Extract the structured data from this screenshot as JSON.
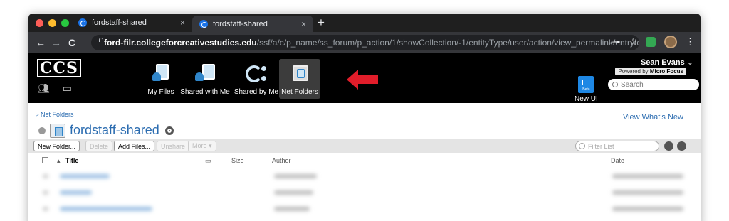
{
  "browser": {
    "tabs": [
      {
        "title": "fordstaff-shared",
        "close": "×"
      },
      {
        "title": "fordstaff-shared",
        "close": "×"
      }
    ],
    "new_tab": "+",
    "nav": {
      "back": "←",
      "forward": "→",
      "reload": "C"
    },
    "url_host": "ford-filr.collegeforcreativestudies.edu",
    "url_path": "/ssf/a/c/p_name/ss_forum/p_action/1/showCollection/-1/entityType/user/action/view_permalink/entryId/ss_us..."
  },
  "app": {
    "logo": "CCS",
    "nav_items": [
      {
        "label": "My Files"
      },
      {
        "label": "Shared with Me"
      },
      {
        "label": "Shared by Me"
      },
      {
        "label": "Net Folders"
      }
    ],
    "new_ui": {
      "label": "New UI",
      "badge": "Beta"
    },
    "user_name": "Sean Evans",
    "powered_by_prefix": "Powered by",
    "powered_by_brand": "Micro Focus",
    "search_placeholder": "Search"
  },
  "content": {
    "breadcrumb": "Net Folders",
    "view_whats_new": "View What's New",
    "folder_title": "fordstaff-shared",
    "actions": [
      "New Folder...",
      "Delete",
      "Add Files...",
      "Unshare",
      "More ▾"
    ],
    "filter_placeholder": "Filter List",
    "columns": {
      "title": "Title",
      "size": "Size",
      "author": "Author",
      "date": "Date"
    }
  },
  "colors": {
    "accent": "#2b6cb0",
    "arrow": "#e11d2a",
    "appbar": "#000000"
  }
}
